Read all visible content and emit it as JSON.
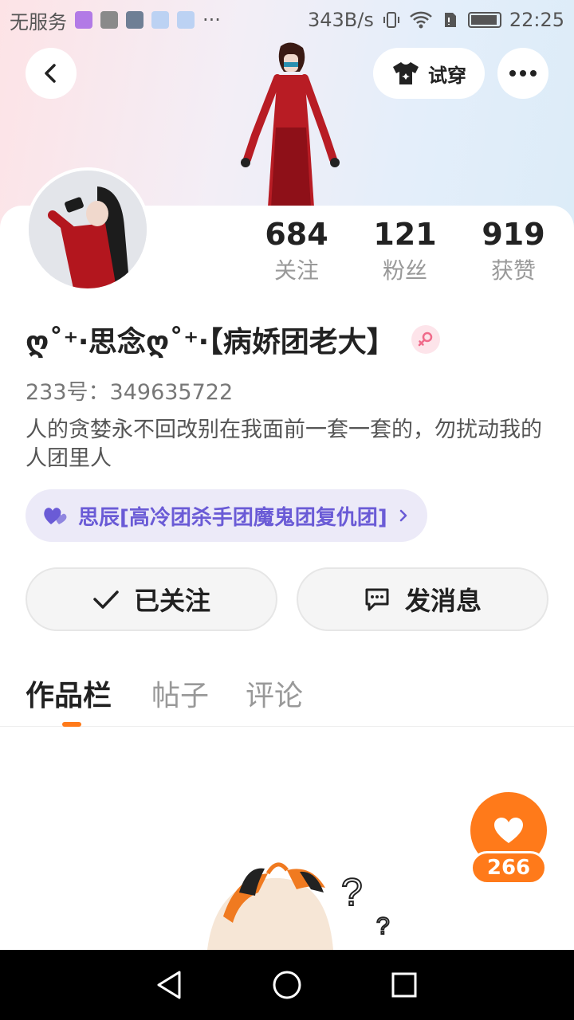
{
  "status_bar": {
    "carrier": "无服务",
    "network_speed": "343B/s",
    "time": "22:25"
  },
  "header": {
    "tryon_label": "试穿"
  },
  "stats": [
    {
      "value": "684",
      "label": "关注"
    },
    {
      "value": "121",
      "label": "粉丝"
    },
    {
      "value": "919",
      "label": "获赞"
    }
  ],
  "profile": {
    "username": "ღ˚⁺‧思念ღ˚⁺‧【病娇团老大】",
    "uid": "233号：349635722",
    "bio": "人的贪婪永不回改别在我面前一套一套的，勿扰动我的人团里人",
    "guild": "思辰[高冷团杀手团魔鬼团复仇团]"
  },
  "actions": {
    "follow_label": "已关注",
    "message_label": "发消息"
  },
  "tabs": [
    "作品栏",
    "帖子",
    "评论"
  ],
  "like": {
    "count": "266"
  },
  "colors": {
    "accent": "#ff7a1a",
    "guild_text": "#6a5bd6",
    "guild_bg": "#eceaf8"
  }
}
